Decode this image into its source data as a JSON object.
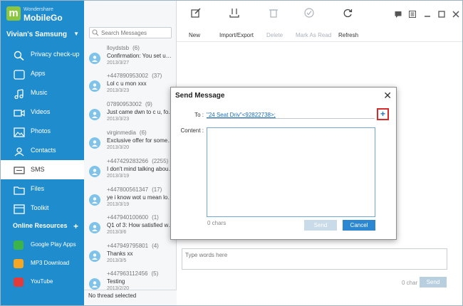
{
  "app": {
    "brand_sub": "Wondershare",
    "brand_name": "MobileGo",
    "logo_letter": "m",
    "device": "Vivian's Samsung"
  },
  "sidebar": {
    "items": [
      {
        "label": "Privacy check-up",
        "icon": "magnifier-icon"
      },
      {
        "label": "Apps",
        "icon": "apps-icon"
      },
      {
        "label": "Music",
        "icon": "music-note-icon"
      },
      {
        "label": "Videos",
        "icon": "video-camera-icon"
      },
      {
        "label": "Photos",
        "icon": "photo-icon"
      },
      {
        "label": "Contacts",
        "icon": "contact-icon"
      },
      {
        "label": "SMS",
        "icon": "sms-icon",
        "active": true
      },
      {
        "label": "Files",
        "icon": "folder-icon"
      },
      {
        "label": "Toolkit",
        "icon": "toolkit-icon"
      }
    ],
    "online_resources": "Online Resources",
    "online_plus": "+",
    "resources": [
      {
        "label": "Google Play Apps",
        "color": "#3bb44a"
      },
      {
        "label": "MP3 Download",
        "color": "#f5a623"
      },
      {
        "label": "YouTube",
        "color": "#e33b3b"
      }
    ]
  },
  "threads": {
    "search_placeholder": "Search Messages",
    "items": [
      {
        "from": "lloydstsb",
        "count": "(6)",
        "snippet": "Confirmation: You set up a...",
        "date": "2013/3/27"
      },
      {
        "from": "+447890953002",
        "count": "(37)",
        "snippet": "Lol c u mon xxx",
        "date": "2013/3/23"
      },
      {
        "from": "07890953002",
        "count": "(9)",
        "snippet": "Just came dwn to c u, forg...",
        "date": "2013/3/23"
      },
      {
        "from": "virginmedia",
        "count": "(6)",
        "snippet": "Exclusive offer for someon...",
        "date": "2013/3/20"
      },
      {
        "from": "+447429283266",
        "count": "(2255)",
        "snippet": "I don't mind talking about e...",
        "date": "2013/3/19"
      },
      {
        "from": "+447800561347",
        "count": "(17)",
        "snippet": "ye i know wot u mean lol, i...",
        "date": "2013/3/19"
      },
      {
        "from": "+447940100600",
        "count": "(1)",
        "snippet": "Q1 of 3: How satisfied wer...",
        "date": "2013/3/6"
      },
      {
        "from": "+447949795801",
        "count": "(4)",
        "snippet": "Thanks xx",
        "date": "2013/3/5"
      },
      {
        "from": "+447963112456",
        "count": "(5)",
        "snippet": "Testing",
        "date": "2013/2/20"
      }
    ],
    "status": "No thread selected"
  },
  "toolbar": {
    "new": "New",
    "import_export": "Import/Export",
    "delete": "Delete",
    "mark_as_read": "Mark As Read",
    "refresh": "Refresh"
  },
  "composer": {
    "placeholder": "Type words here",
    "count": "0 char",
    "send": "Send"
  },
  "dialog": {
    "title": "Send Message",
    "close": "✕",
    "to_label": "To :",
    "recipient": "\"24 Seat Driv\"<92822738>;",
    "add": "+",
    "content_label": "Content :",
    "chars": "0 chars",
    "send": "Send",
    "cancel": "Cancel"
  }
}
